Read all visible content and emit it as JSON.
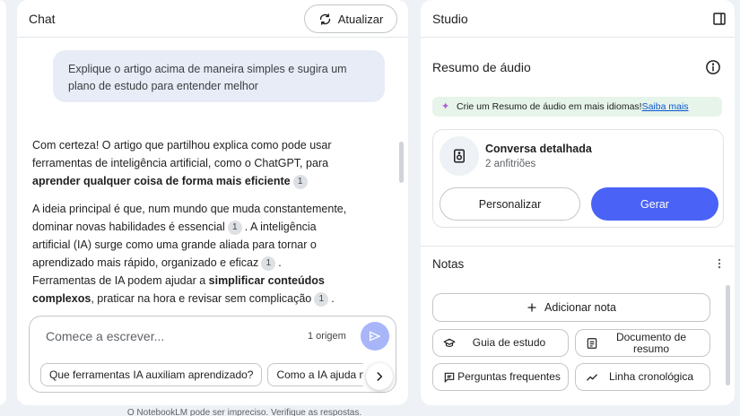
{
  "chat": {
    "title": "Chat",
    "refresh_label": "Atualizar",
    "user_message": "Explique o artigo acima de maneira simples e sugira um plano de estudo para entender melhor",
    "answer": {
      "p1_a": "Com certeza! O artigo que partilhou explica como pode usar ferramentas de inteligência artificial, como o ChatGPT, para ",
      "p1_bold": "aprender qualquer coisa de forma mais eficiente",
      "p2_a": "A ideia principal é que, num mundo que muda constantemente, dominar novas habilidades é essencial",
      "p2_b": ". A inteligência artificial (IA) surge como uma grande aliada para tornar o aprendizado mais rápido, organizado e eficaz",
      "p2_c": ". Ferramentas de IA podem ajudar a ",
      "p2_bold": "simplificar conteúdos complexos",
      "p2_d": ", praticar na hora e revisar sem complicação",
      "p2_e": ".",
      "citation": "1"
    },
    "composer": {
      "placeholder": "Comece a escrever...",
      "sources_count": "1 origem"
    },
    "suggestions": [
      "Que ferramentas IA auxiliam aprendizado?",
      "Como a IA ajuda na"
    ],
    "disclaimer": "O NotebookLM pode ser impreciso. Verifique as respostas."
  },
  "studio": {
    "title": "Studio",
    "audio_overview": {
      "title": "Resumo de áudio",
      "promo_text": "Crie um Resumo de áudio em mais idiomas!",
      "promo_link": "Saiba mais",
      "card_title": "Conversa detalhada",
      "card_subtitle": "2 anfitriões",
      "customize_label": "Personalizar",
      "generate_label": "Gerar"
    },
    "notes": {
      "title": "Notas",
      "add_note_label": "Adicionar nota",
      "tools": {
        "study_guide": "Guia de estudo",
        "briefing_doc": "Documento de resumo",
        "faq": "Perguntas frequentes",
        "timeline": "Linha cronológica"
      }
    }
  },
  "colors": {
    "accent": "#4a62f5",
    "send_button": "#a8b6f9",
    "user_bubble": "#e8ecf6",
    "promo_bg": "#e6f4ea"
  }
}
